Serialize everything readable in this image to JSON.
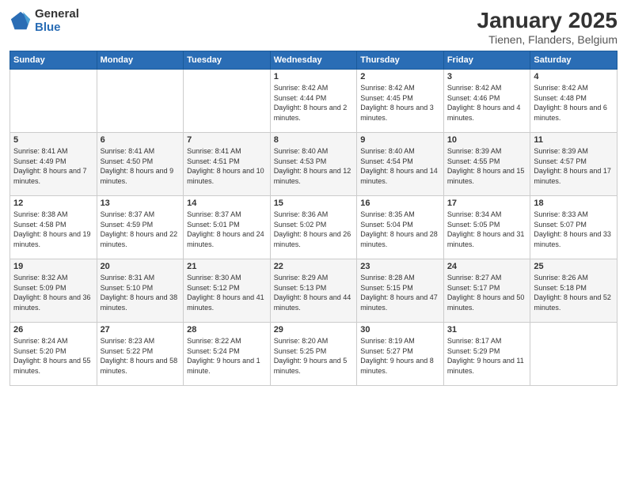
{
  "header": {
    "logo_general": "General",
    "logo_blue": "Blue",
    "title": "January 2025",
    "subtitle": "Tienen, Flanders, Belgium"
  },
  "days_of_week": [
    "Sunday",
    "Monday",
    "Tuesday",
    "Wednesday",
    "Thursday",
    "Friday",
    "Saturday"
  ],
  "weeks": [
    [
      {
        "day": "",
        "info": ""
      },
      {
        "day": "",
        "info": ""
      },
      {
        "day": "",
        "info": ""
      },
      {
        "day": "1",
        "info": "Sunrise: 8:42 AM\nSunset: 4:44 PM\nDaylight: 8 hours and 2 minutes."
      },
      {
        "day": "2",
        "info": "Sunrise: 8:42 AM\nSunset: 4:45 PM\nDaylight: 8 hours and 3 minutes."
      },
      {
        "day": "3",
        "info": "Sunrise: 8:42 AM\nSunset: 4:46 PM\nDaylight: 8 hours and 4 minutes."
      },
      {
        "day": "4",
        "info": "Sunrise: 8:42 AM\nSunset: 4:48 PM\nDaylight: 8 hours and 6 minutes."
      }
    ],
    [
      {
        "day": "5",
        "info": "Sunrise: 8:41 AM\nSunset: 4:49 PM\nDaylight: 8 hours and 7 minutes."
      },
      {
        "day": "6",
        "info": "Sunrise: 8:41 AM\nSunset: 4:50 PM\nDaylight: 8 hours and 9 minutes."
      },
      {
        "day": "7",
        "info": "Sunrise: 8:41 AM\nSunset: 4:51 PM\nDaylight: 8 hours and 10 minutes."
      },
      {
        "day": "8",
        "info": "Sunrise: 8:40 AM\nSunset: 4:53 PM\nDaylight: 8 hours and 12 minutes."
      },
      {
        "day": "9",
        "info": "Sunrise: 8:40 AM\nSunset: 4:54 PM\nDaylight: 8 hours and 14 minutes."
      },
      {
        "day": "10",
        "info": "Sunrise: 8:39 AM\nSunset: 4:55 PM\nDaylight: 8 hours and 15 minutes."
      },
      {
        "day": "11",
        "info": "Sunrise: 8:39 AM\nSunset: 4:57 PM\nDaylight: 8 hours and 17 minutes."
      }
    ],
    [
      {
        "day": "12",
        "info": "Sunrise: 8:38 AM\nSunset: 4:58 PM\nDaylight: 8 hours and 19 minutes."
      },
      {
        "day": "13",
        "info": "Sunrise: 8:37 AM\nSunset: 4:59 PM\nDaylight: 8 hours and 22 minutes."
      },
      {
        "day": "14",
        "info": "Sunrise: 8:37 AM\nSunset: 5:01 PM\nDaylight: 8 hours and 24 minutes."
      },
      {
        "day": "15",
        "info": "Sunrise: 8:36 AM\nSunset: 5:02 PM\nDaylight: 8 hours and 26 minutes."
      },
      {
        "day": "16",
        "info": "Sunrise: 8:35 AM\nSunset: 5:04 PM\nDaylight: 8 hours and 28 minutes."
      },
      {
        "day": "17",
        "info": "Sunrise: 8:34 AM\nSunset: 5:05 PM\nDaylight: 8 hours and 31 minutes."
      },
      {
        "day": "18",
        "info": "Sunrise: 8:33 AM\nSunset: 5:07 PM\nDaylight: 8 hours and 33 minutes."
      }
    ],
    [
      {
        "day": "19",
        "info": "Sunrise: 8:32 AM\nSunset: 5:09 PM\nDaylight: 8 hours and 36 minutes."
      },
      {
        "day": "20",
        "info": "Sunrise: 8:31 AM\nSunset: 5:10 PM\nDaylight: 8 hours and 38 minutes."
      },
      {
        "day": "21",
        "info": "Sunrise: 8:30 AM\nSunset: 5:12 PM\nDaylight: 8 hours and 41 minutes."
      },
      {
        "day": "22",
        "info": "Sunrise: 8:29 AM\nSunset: 5:13 PM\nDaylight: 8 hours and 44 minutes."
      },
      {
        "day": "23",
        "info": "Sunrise: 8:28 AM\nSunset: 5:15 PM\nDaylight: 8 hours and 47 minutes."
      },
      {
        "day": "24",
        "info": "Sunrise: 8:27 AM\nSunset: 5:17 PM\nDaylight: 8 hours and 50 minutes."
      },
      {
        "day": "25",
        "info": "Sunrise: 8:26 AM\nSunset: 5:18 PM\nDaylight: 8 hours and 52 minutes."
      }
    ],
    [
      {
        "day": "26",
        "info": "Sunrise: 8:24 AM\nSunset: 5:20 PM\nDaylight: 8 hours and 55 minutes."
      },
      {
        "day": "27",
        "info": "Sunrise: 8:23 AM\nSunset: 5:22 PM\nDaylight: 8 hours and 58 minutes."
      },
      {
        "day": "28",
        "info": "Sunrise: 8:22 AM\nSunset: 5:24 PM\nDaylight: 9 hours and 1 minute."
      },
      {
        "day": "29",
        "info": "Sunrise: 8:20 AM\nSunset: 5:25 PM\nDaylight: 9 hours and 5 minutes."
      },
      {
        "day": "30",
        "info": "Sunrise: 8:19 AM\nSunset: 5:27 PM\nDaylight: 9 hours and 8 minutes."
      },
      {
        "day": "31",
        "info": "Sunrise: 8:17 AM\nSunset: 5:29 PM\nDaylight: 9 hours and 11 minutes."
      },
      {
        "day": "",
        "info": ""
      }
    ]
  ]
}
